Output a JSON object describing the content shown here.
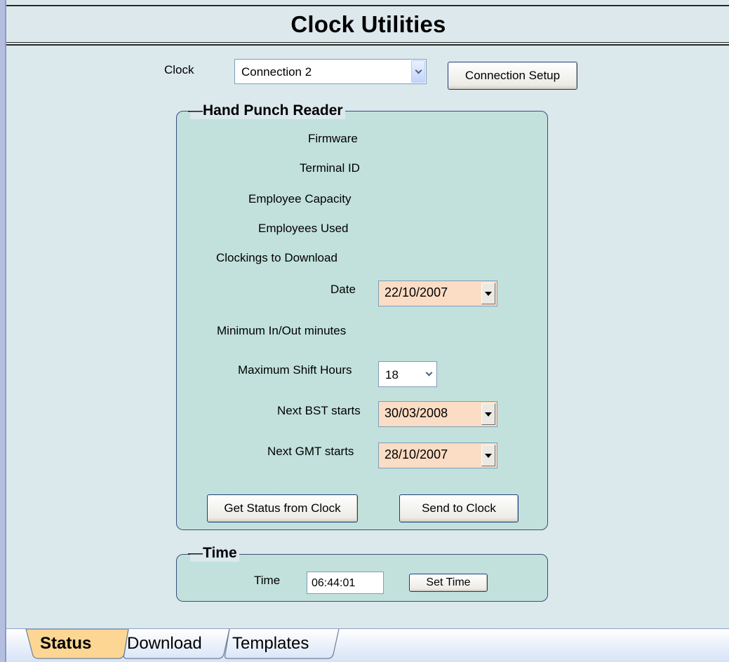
{
  "window": {
    "title": "Clock Utilities"
  },
  "clock": {
    "label": "Clock",
    "selected": "Connection 2",
    "setup_button": "Connection Setup"
  },
  "reader": {
    "group_title": "Hand Punch Reader",
    "firmware_label": "Firmware",
    "terminal_id_label": "Terminal ID",
    "capacity_label": "Employee Capacity",
    "used_label": "Employees Used",
    "clockings_label": "Clockings to Download",
    "date_label": "Date",
    "date_value": "22/10/2007",
    "min_inout_label": "Minimum In/Out minutes",
    "max_shift_label": "Maximum Shift Hours",
    "max_shift_value": "18",
    "bst_label": "Next BST starts",
    "bst_value": "30/03/2008",
    "gmt_label": "Next GMT starts",
    "gmt_value": "28/10/2007",
    "get_status_button": "Get Status from Clock",
    "send_button": "Send to Clock"
  },
  "time": {
    "group_title": "Time",
    "label": "Time",
    "value": "06:44:01",
    "set_button": "Set Time"
  },
  "tabs": [
    {
      "label": "Status",
      "active": true
    },
    {
      "label": "Download",
      "active": false
    },
    {
      "label": "Templates",
      "active": false
    }
  ],
  "colors": {
    "panel_bg": "#dbe8ec",
    "group_bg": "#c2e1dc",
    "date_field_bg": "#fbdcc4",
    "active_tab": "#fbd08c"
  }
}
